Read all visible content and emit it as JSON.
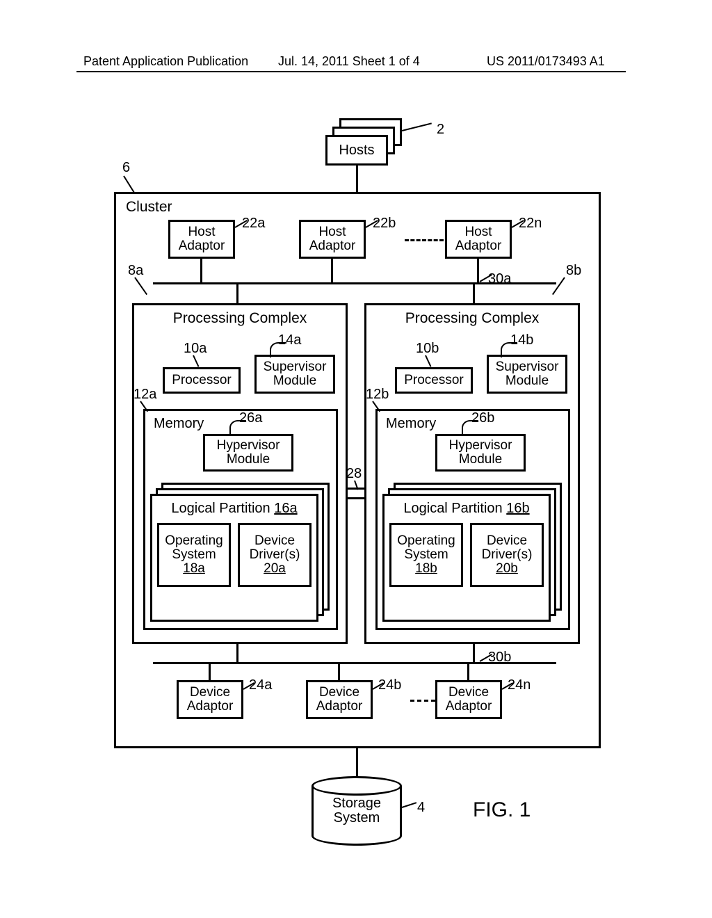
{
  "header": {
    "left": "Patent Application Publication",
    "middle": "Jul. 14, 2011  Sheet 1 of 4",
    "right": "US 2011/0173493 A1"
  },
  "fig_label": "FIG. 1",
  "refs": {
    "hosts": "2",
    "storage": "4",
    "cluster": "6",
    "pc_a": "8a",
    "pc_b": "8b",
    "proc_a": "10a",
    "proc_b": "10b",
    "mem_a": "12a",
    "mem_b": "12b",
    "sup_a": "14a",
    "sup_b": "14b",
    "lp_a": "16a",
    "lp_b": "16b",
    "os_a": "18a",
    "os_b": "18b",
    "dd_a": "20a",
    "dd_b": "20b",
    "ha_a": "22a",
    "ha_b": "22b",
    "ha_n": "22n",
    "da_a": "24a",
    "da_b": "24b",
    "da_n": "24n",
    "hyp_a": "26a",
    "hyp_b": "26b",
    "conn": "28",
    "bus_top": "30a",
    "bus_bot": "30b"
  },
  "labels": {
    "hosts": "Hosts",
    "cluster": "Cluster",
    "host_adaptor": "Host\nAdaptor",
    "processing_complex": "Processing Complex",
    "processor": "Processor",
    "supervisor_module": "Supervisor\nModule",
    "memory": "Memory",
    "hypervisor_module": "Hypervisor\nModule",
    "logical_partition": "Logical Partition",
    "operating_system": "Operating\nSystem",
    "device_drivers": "Device\nDriver(s)",
    "device_adaptor": "Device\nAdaptor",
    "storage_system": "Storage\nSystem"
  }
}
